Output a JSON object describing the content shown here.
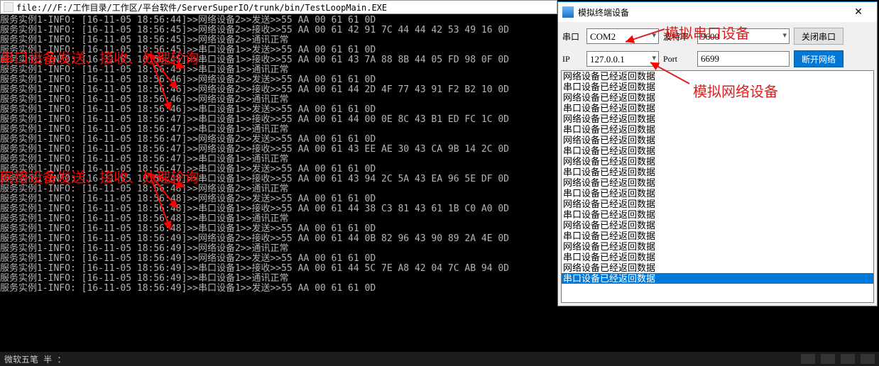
{
  "addr": "file:///F:/工作目录/工作区/平台软件/ServerSuperIO/trunk/bin/TestLoopMain.EXE",
  "console_lines": [
    "服务实例1-INFO: [16-11-05 18:56:44]>>网络设备2>>发送>>55 AA 00 61 61 0D",
    "服务实例1-INFO: [16-11-05 18:56:45]>>网络设备2>>接收>>55 AA 00 61 42 91 7C 44 44 42 53 49 16 0D",
    "服务实例1-INFO: [16-11-05 18:56:45]>>网络设备2>>通讯正常",
    "服务实例1-INFO: [16-11-05 18:56:45]>>串口设备1>>发送>>55 AA 00 61 61 0D",
    "服务实例1-INFO: [16-11-05 18:56:45]>>串口设备1>>接收>>55 AA 00 61 43 7A 88 8B 44 05 FD 98 0F 0D",
    "服务实例1-INFO: [16-11-05 18:56:45]>>串口设备1>>通讯正常",
    "服务实例1-INFO: [16-11-05 18:56:46]>>网络设备2>>发送>>55 AA 00 61 61 0D",
    "服务实例1-INFO: [16-11-05 18:56:46]>>网络设备2>>接收>>55 AA 00 61 44 2D 4F 77 43 91 F2 B2 10 0D",
    "服务实例1-INFO: [16-11-05 18:56:46]>>网络设备2>>通讯正常",
    "服务实例1-INFO: [16-11-05 18:56:46]>>串口设备1>>发送>>55 AA 00 61 61 0D",
    "服务实例1-INFO: [16-11-05 18:56:47]>>串口设备1>>接收>>55 AA 00 61 44 00 0E 8C 43 B1 ED FC 1C 0D",
    "服务实例1-INFO: [16-11-05 18:56:47]>>串口设备1>>通讯正常",
    "服务实例1-INFO: [16-11-05 18:56:47]>>网络设备2>>发送>>55 AA 00 61 61 0D",
    "服务实例1-INFO: [16-11-05 18:56:47]>>网络设备2>>接收>>55 AA 00 61 43 EE AE 30 43 CA 9B 14 2C 0D",
    "服务实例1-INFO: [16-11-05 18:56:47]>>串口设备1>>通讯正常",
    "服务实例1-INFO: [16-11-05 18:56:47]>>串口设备1>>发送>>55 AA 00 61 61 0D",
    "服务实例1-INFO: [16-11-05 18:56:48]>>串口设备1>>接收>>55 AA 00 61 43 94 2C 5A 43 EA 96 5E DF 0D",
    "服务实例1-INFO: [16-11-05 18:56:48]>>网络设备2>>通讯正常",
    "服务实例1-INFO: [16-11-05 18:56:48]>>网络设备2>>发送>>55 AA 00 61 61 0D",
    "服务实例1-INFO: [16-11-05 18:56:48]>>串口设备1>>接收>>55 AA 00 61 44 38 C3 81 43 61 1B C0 A0 0D",
    "服务实例1-INFO: [16-11-05 18:56:48]>>串口设备1>>通讯正常",
    "服务实例1-INFO: [16-11-05 18:56:48]>>串口设备1>>发送>>55 AA 00 61 61 0D",
    "服务实例1-INFO: [16-11-05 18:56:49]>>网络设备2>>接收>>55 AA 00 61 44 0B 82 96 43 90 89 2A 4E 0D",
    "服务实例1-INFO: [16-11-05 18:56:49]>>网络设备2>>通讯正常",
    "服务实例1-INFO: [16-11-05 18:56:49]>>网络设备2>>发送>>55 AA 00 61 61 0D",
    "服务实例1-INFO: [16-11-05 18:56:49]>>串口设备1>>接收>>55 AA 00 61 44 5C 7E A8 42 04 7C AB 94 0D",
    "服务实例1-INFO: [16-11-05 18:56:49]>>串口设备1>>通讯正常",
    "服务实例1-INFO: [16-11-05 18:56:49]>>串口设备1>>发送>>55 AA 00 61 61 0D"
  ],
  "annot1": "串口设备发送、接收、处理轮询",
  "annot2": "网络设备发送、接收、处理轮询",
  "modal": {
    "title": "模拟终端设备",
    "serial_lbl": "串口",
    "baud_lbl": "波特率",
    "ip_lbl": "IP",
    "port_lbl": "Port",
    "com_value": "COM2",
    "baud_value": "9600",
    "ip_value": "127.0.0.1",
    "port_value": "6699",
    "btn_close_serial": "关闭串口",
    "btn_disconnect": "断开网络",
    "annot_serial": "模拟串口设备",
    "annot_net": "模拟网络设备"
  },
  "list_items": [
    "网络设备已经返回数据",
    "串口设备已经返回数据",
    "网络设备已经返回数据",
    "串口设备已经返回数据",
    "网络设备已经返回数据",
    "串口设备已经返回数据",
    "网络设备已经返回数据",
    "串口设备已经返回数据",
    "网络设备已经返回数据",
    "串口设备已经返回数据",
    "网络设备已经返回数据",
    "串口设备已经返回数据",
    "网络设备已经返回数据",
    "串口设备已经返回数据",
    "网络设备已经返回数据",
    "串口设备已经返回数据",
    "网络设备已经返回数据",
    "串口设备已经返回数据",
    "网络设备已经返回数据",
    "串口设备已经返回数据"
  ],
  "ime": "微软五笔 半 ："
}
